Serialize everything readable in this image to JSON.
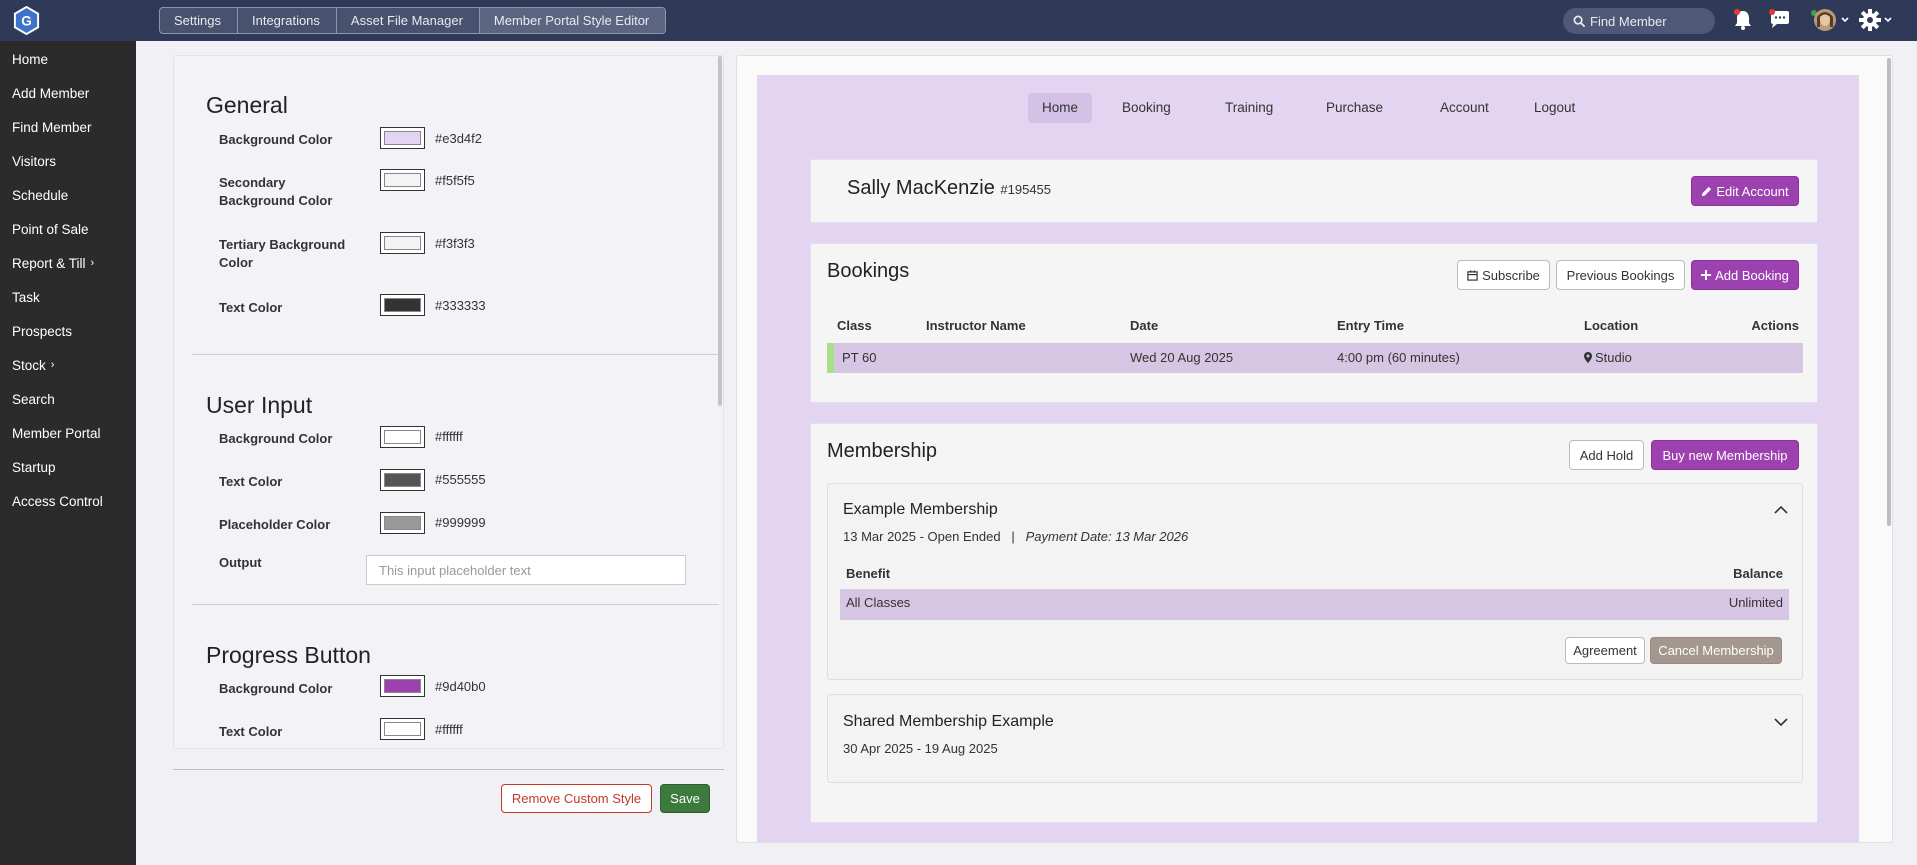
{
  "topbar": {
    "logo_letter": "G",
    "breadcrumbs": [
      "Settings",
      "Integrations",
      "Asset File Manager",
      "Member Portal Style Editor"
    ],
    "search_placeholder": "Find Member"
  },
  "sidebar": {
    "items": [
      {
        "label": "Home",
        "chevron": ""
      },
      {
        "label": "Add Member",
        "chevron": ""
      },
      {
        "label": "Find Member",
        "chevron": ""
      },
      {
        "label": "Visitors",
        "chevron": ""
      },
      {
        "label": "Schedule",
        "chevron": ""
      },
      {
        "label": "Point of Sale",
        "chevron": ""
      },
      {
        "label": "Report & Till",
        "chevron": "›"
      },
      {
        "label": "Task",
        "chevron": ""
      },
      {
        "label": "Prospects",
        "chevron": ""
      },
      {
        "label": "Stock",
        "chevron": "›"
      },
      {
        "label": "Search",
        "chevron": ""
      },
      {
        "label": "Member Portal",
        "chevron": ""
      },
      {
        "label": "Startup",
        "chevron": ""
      },
      {
        "label": "Access Control",
        "chevron": ""
      }
    ]
  },
  "editor": {
    "general": {
      "title": "General",
      "rows": [
        {
          "label": "Background Color",
          "color": "#e3d4f2",
          "hex": "#e3d4f2"
        },
        {
          "label": "Secondary Background Color",
          "color": "#f5f5f5",
          "hex": "#f5f5f5"
        },
        {
          "label": "Tertiary Background Color",
          "color": "#f3f3f3",
          "hex": "#f3f3f3"
        },
        {
          "label": "Text Color",
          "color": "#333333",
          "hex": "#333333"
        }
      ]
    },
    "user_input": {
      "title": "User Input",
      "rows": [
        {
          "label": "Background Color",
          "color": "#ffffff",
          "hex": "#ffffff"
        },
        {
          "label": "Text Color",
          "color": "#555555",
          "hex": "#555555"
        },
        {
          "label": "Placeholder Color",
          "color": "#999999",
          "hex": "#999999"
        }
      ],
      "output_label": "Output",
      "output_placeholder": "This input placeholder text"
    },
    "progress_button": {
      "title": "Progress Button",
      "rows": [
        {
          "label": "Background Color",
          "color": "#9d40b0",
          "hex": "#9d40b0"
        },
        {
          "label": "Text Color",
          "color": "#ffffff",
          "hex": "#ffffff"
        }
      ]
    },
    "remove_label": "Remove Custom Style",
    "save_label": "Save"
  },
  "preview": {
    "nav": [
      "Home",
      "Booking",
      "Training",
      "Purchase",
      "Account",
      "Logout"
    ],
    "member": {
      "name": "Sally MacKenzie",
      "id": "#195455",
      "edit_label": "Edit Account"
    },
    "bookings": {
      "title": "Bookings",
      "subscribe_label": "Subscribe",
      "previous_label": "Previous Bookings",
      "add_label": "Add Booking",
      "columns": [
        "Class",
        "Instructor Name",
        "Date",
        "Entry Time",
        "Location",
        "Actions"
      ],
      "rows": [
        {
          "class": "PT 60",
          "instructor": "",
          "date": "Wed 20 Aug 2025",
          "time": "4:00 pm (60 minutes)",
          "location": "Studio"
        }
      ]
    },
    "membership": {
      "title": "Membership",
      "hold_label": "Add Hold",
      "buy_label": "Buy new Membership",
      "items": [
        {
          "name": "Example Membership",
          "dates": "13 Mar 2025 - Open Ended",
          "separator": "|",
          "payment": "Payment Date: 13 Mar 2026",
          "benefit_header": "Benefit",
          "balance_header": "Balance",
          "benefit": "All Classes",
          "balance": "Unlimited",
          "agreement_label": "Agreement",
          "cancel_label": "Cancel Membership"
        },
        {
          "name": "Shared Membership Example",
          "dates": "30 Apr 2025 - 19 Aug 2025"
        }
      ]
    }
  },
  "colors": {
    "topbar": "#2f3a58",
    "sidebar": "#2b2b2b",
    "accent": "#9d40b0",
    "save": "#3d7a3d",
    "remove": "#c0392b"
  }
}
